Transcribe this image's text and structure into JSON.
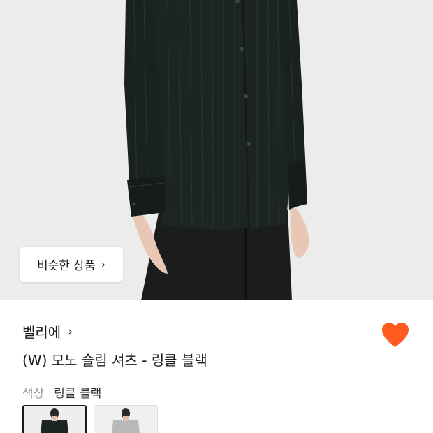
{
  "product": {
    "image_alt": "product-photo",
    "similar_button_label": "비슷한 상품",
    "brand": "벨리에",
    "title": "(W) 모노 슬림 셔츠 - 링클 블랙",
    "color_label": "색상",
    "color_value": "링클 블랙",
    "wishlisted": true
  },
  "colors": {
    "wish_heart": "#ff5a1f",
    "shirt": "#1d2424",
    "background": "#ececec"
  },
  "swatches": [
    {
      "name": "링클 블랙",
      "selected": true
    },
    {
      "name": "other-color",
      "selected": false
    }
  ],
  "icons": {
    "chevron": "chevron-right-icon",
    "wish": "heart-icon"
  }
}
